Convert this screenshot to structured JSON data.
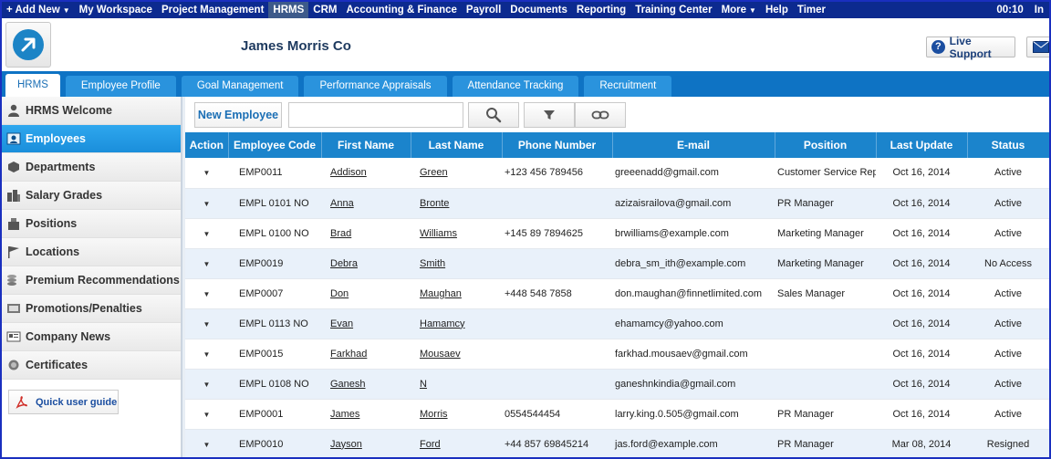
{
  "topnav": {
    "left": [
      "+ Add New",
      "My Workspace",
      "Project Management",
      "HRMS",
      "CRM",
      "Accounting & Finance",
      "Payroll",
      "Documents",
      "Reporting",
      "Training Center",
      "More",
      "Help",
      "Timer"
    ],
    "active": "HRMS",
    "time": "00:10",
    "user": "In"
  },
  "header": {
    "company": "James Morris Co",
    "live_support": "Live Support"
  },
  "tabs": [
    "HRMS",
    "Employee Profile",
    "Goal Management",
    "Performance Appraisals",
    "Attendance Tracking",
    "Recruitment"
  ],
  "sidebar": {
    "items": [
      "HRMS Welcome",
      "Employees",
      "Departments",
      "Salary Grades",
      "Positions",
      "Locations",
      "Premium Recommendations",
      "Promotions/Penalties",
      "Company News",
      "Certificates"
    ],
    "active": "Employees",
    "guide": "Quick user guide"
  },
  "toolbar": {
    "new_employee": "New Employee",
    "search_value": ""
  },
  "grid": {
    "columns": [
      "Action",
      "Employee Code",
      "First Name",
      "Last Name",
      "Phone Number",
      "E-mail",
      "Position",
      "Last Update",
      "Status"
    ],
    "rows": [
      [
        "EMP0011",
        "Addison",
        "Green",
        "+123 456 789456",
        "greeenadd@gmail.com",
        "Customer Service Rep",
        "Oct 16, 2014",
        "Active"
      ],
      [
        "EMPL 0101 NO",
        "Anna",
        "Bronte",
        "",
        "azizaisrailova@gmail.com",
        "PR Manager",
        "Oct 16, 2014",
        "Active"
      ],
      [
        "EMPL 0100 NO",
        "Brad",
        "Williams",
        "+145 89 7894625",
        "brwilliams@example.com",
        "Marketing Manager",
        "Oct 16, 2014",
        "Active"
      ],
      [
        "EMP0019",
        "Debra",
        "Smith",
        "",
        "debra_sm_ith@example.com",
        "Marketing Manager",
        "Oct 16, 2014",
        "No Access"
      ],
      [
        "EMP0007",
        "Don",
        "Maughan",
        "+448 548 7858",
        "don.maughan@finnetlimited.com",
        "Sales Manager",
        "Oct 16, 2014",
        "Active"
      ],
      [
        "EMPL 0113 NO",
        "Evan",
        "Hamamcy",
        "",
        "ehamamcy@yahoo.com",
        "",
        "Oct 16, 2014",
        "Active"
      ],
      [
        "EMP0015",
        "Farkhad",
        "Mousaev",
        "",
        "farkhad.mousaev@gmail.com",
        "",
        "Oct 16, 2014",
        "Active"
      ],
      [
        "EMPL 0108 NO",
        "Ganesh",
        "N",
        "",
        "ganeshnkindia@gmail.com",
        "",
        "Oct 16, 2014",
        "Active"
      ],
      [
        "EMP0001",
        "James",
        "Morris",
        "0554544454",
        "larry.king.0.505@gmail.com",
        "PR Manager",
        "Oct 16, 2014",
        "Active"
      ],
      [
        "EMP0010",
        "Jayson",
        "Ford",
        "+44 857 69845214",
        "jas.ford@example.com",
        "PR Manager",
        "Mar 08, 2014",
        "Resigned"
      ]
    ]
  },
  "colors": {
    "topnav": "#0c2a8f",
    "tabsbar": "#0e73c4",
    "header_row": "#1b84cc",
    "active_side": "#1a8edb"
  }
}
